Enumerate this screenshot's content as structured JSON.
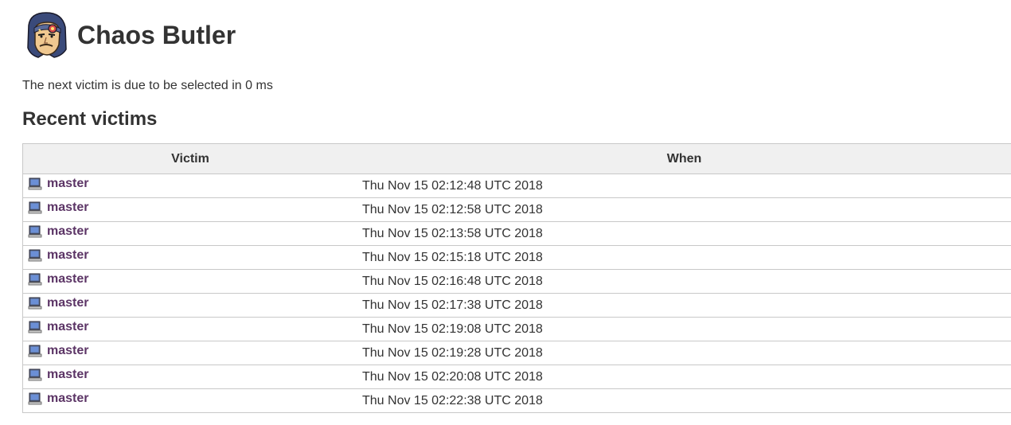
{
  "app": {
    "title": "Chaos Butler",
    "logo_icon": "butler-face-icon"
  },
  "status": {
    "next_victim_text": "The next victim is due to be selected in 0 ms"
  },
  "recent": {
    "heading": "Recent victims",
    "columns": {
      "victim": "Victim",
      "when": "When"
    },
    "rows": [
      {
        "victim": "master",
        "when": "Thu Nov 15 02:12:48 UTC 2018"
      },
      {
        "victim": "master",
        "when": "Thu Nov 15 02:12:58 UTC 2018"
      },
      {
        "victim": "master",
        "when": "Thu Nov 15 02:13:58 UTC 2018"
      },
      {
        "victim": "master",
        "when": "Thu Nov 15 02:15:18 UTC 2018"
      },
      {
        "victim": "master",
        "when": "Thu Nov 15 02:16:48 UTC 2018"
      },
      {
        "victim": "master",
        "when": "Thu Nov 15 02:17:38 UTC 2018"
      },
      {
        "victim": "master",
        "when": "Thu Nov 15 02:19:08 UTC 2018"
      },
      {
        "victim": "master",
        "when": "Thu Nov 15 02:19:28 UTC 2018"
      },
      {
        "victim": "master",
        "when": "Thu Nov 15 02:20:08 UTC 2018"
      },
      {
        "victim": "master",
        "when": "Thu Nov 15 02:22:38 UTC 2018"
      }
    ]
  },
  "colors": {
    "link": "#5c3566",
    "header_bg": "#f0f0f0",
    "border": "#c8c8c8",
    "text": "#333333"
  }
}
